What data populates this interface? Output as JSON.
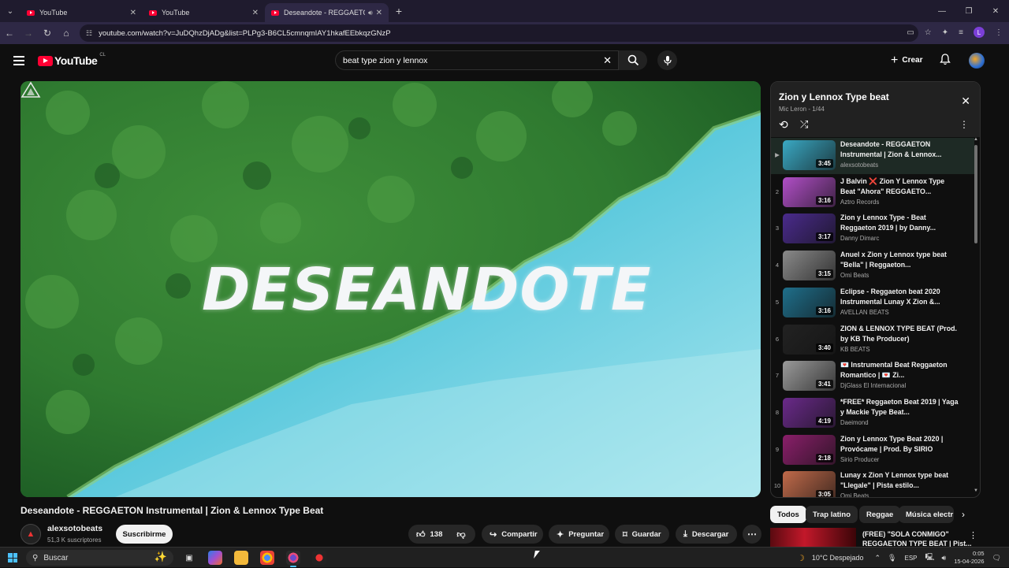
{
  "browser": {
    "tabs": [
      {
        "label": "YouTube",
        "active": false
      },
      {
        "label": "YouTube",
        "active": false
      },
      {
        "label": "Deseandote - REGGAETON",
        "active": true
      }
    ],
    "url": "youtube.com/watch?v=JuDQhzDjADg&list=PLPg3-B6CL5cmnqmIAY1hkafEEbkqzGNzP",
    "profile_initial": "L"
  },
  "youtube": {
    "logo_text": "YouTube",
    "country": "CL",
    "search_value": "beat type zion y lennox",
    "create_label": "Crear"
  },
  "video": {
    "overlay_text": "DESEANDOTE",
    "title": "Deseandote - REGGAETON Instrumental | Zion & Lennox Type Beat",
    "channel": "alexsotobeats",
    "subscribers": "51,3 K suscriptores",
    "subscribe_label": "Suscribirme",
    "likes": "138",
    "share_label": "Compartir",
    "ask_label": "Preguntar",
    "save_label": "Guardar",
    "download_label": "Descargar"
  },
  "playlist": {
    "title": "Zion y Lennox Type beat",
    "subtitle": "Mic Leron - 1/44",
    "items": [
      {
        "index": "▶",
        "title": "Deseandote - REGGAETON Instrumental | Zion & Lennox...",
        "channel": "alexsotobeats",
        "duration": "3:45",
        "thumb": "#3aa9c4"
      },
      {
        "index": "2",
        "title": "J Balvin ❌ Zion Y Lennox Type Beat \"Ahora\" REGGAETO...",
        "channel": "Aztro Records",
        "duration": "3:16",
        "thumb": "#b14fc7"
      },
      {
        "index": "3",
        "title": "Zion y Lennox Type - Beat Reggaeton 2019 | by Danny...",
        "channel": "Danny Dimarc",
        "duration": "3:17",
        "thumb": "#4a2b8c"
      },
      {
        "index": "4",
        "title": "Anuel x Zion y Lennox type beat \"Bella\" | Reggaeton...",
        "channel": "Omi Beats",
        "duration": "3:15",
        "thumb": "#8a8a8a"
      },
      {
        "index": "5",
        "title": "Eclipse - Reggaeton beat 2020 Instrumental Lunay X Zion &...",
        "channel": "AVELLAN BEATS",
        "duration": "3:16",
        "thumb": "#1f6f8b"
      },
      {
        "index": "6",
        "title": "ZION & LENNOX TYPE BEAT (Prod. by KB The Producer)",
        "channel": "KB BEATS",
        "duration": "3:40",
        "thumb": "#222222"
      },
      {
        "index": "7",
        "title": "💌 Instrumental Beat Reggaeton Romantico | 💌 Zi...",
        "channel": "DjGlass El Internacional",
        "duration": "3:41",
        "thumb": "#9a9a9a"
      },
      {
        "index": "8",
        "title": "*FREE* Reggaeton Beat 2019 | Yaga y Mackie Type Beat...",
        "channel": "Daeimond",
        "duration": "4:19",
        "thumb": "#6a2a8a"
      },
      {
        "index": "9",
        "title": "Zion y Lennox Type Beat 2020 | Provócame | Prod. By SIRIO",
        "channel": "Sirio Producer",
        "duration": "2:18",
        "thumb": "#8a1f6a"
      },
      {
        "index": "10",
        "title": "Lunay x Zion Y Lennox type beat \"Llegale\" | Pista estilo...",
        "channel": "Omi Beats",
        "duration": "3:05",
        "thumb": "#c06a4a"
      }
    ]
  },
  "chips": [
    "Todos",
    "Trap latino",
    "Reggae",
    "Música electr"
  ],
  "next_video": {
    "title": "(FREE) \"SOLA CONMIGO\" REGGAETON TYPE BEAT | Pist..."
  },
  "taskbar": {
    "search_placeholder": "Buscar",
    "weather": "10°C  Despejado",
    "language": "ESP",
    "time": "0:05",
    "date": "15-04-2026"
  }
}
